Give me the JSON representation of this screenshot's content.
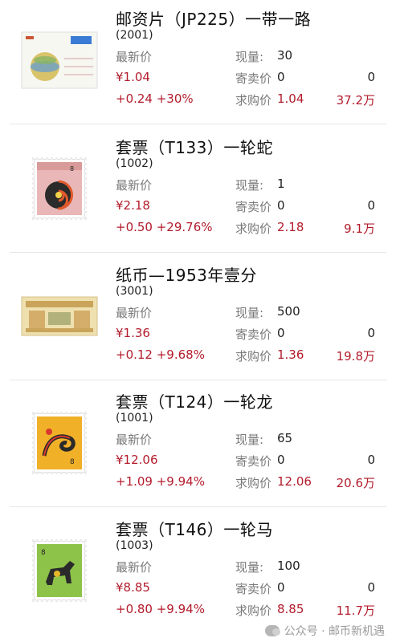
{
  "labels": {
    "latest_price": "最新价",
    "stock": "现量:",
    "consign": "寄卖价",
    "bid": "求购价"
  },
  "items": [
    {
      "title": "邮资片（JP225）一带一路",
      "code": "(2001)",
      "price": "¥1.04",
      "change": "+0.24 +30%",
      "stock_value": "30",
      "consign_value": "0",
      "consign_count": "0",
      "bid_value": "1.04",
      "bid_amount": "37.2万",
      "image": "postal-card"
    },
    {
      "title": "套票（T133）一轮蛇",
      "code": "(1002)",
      "price": "¥2.18",
      "change": "+0.50 +29.76%",
      "stock_value": "1",
      "consign_value": "0",
      "consign_count": "0",
      "bid_value": "2.18",
      "bid_amount": "9.1万",
      "image": "snake-stamp"
    },
    {
      "title": "纸币—1953年壹分",
      "code": "(3001)",
      "price": "¥1.36",
      "change": "+0.12 +9.68%",
      "stock_value": "500",
      "consign_value": "0",
      "consign_count": "0",
      "bid_value": "1.36",
      "bid_amount": "19.8万",
      "image": "banknote"
    },
    {
      "title": "套票（T124）一轮龙",
      "code": "(1001)",
      "price": "¥12.06",
      "change": "+1.09 +9.94%",
      "stock_value": "65",
      "consign_value": "0",
      "consign_count": "0",
      "bid_value": "12.06",
      "bid_amount": "20.6万",
      "image": "dragon-stamp"
    },
    {
      "title": "套票（T146）一轮马",
      "code": "(1003)",
      "price": "¥8.85",
      "change": "+0.80 +9.94%",
      "stock_value": "100",
      "consign_value": "0",
      "consign_count": "0",
      "bid_value": "8.85",
      "bid_amount": "11.7万",
      "image": "horse-stamp"
    }
  ],
  "watermark": {
    "text": "公众号 · 邮币新机遇"
  },
  "colors": {
    "accent_red": "#b31c2c",
    "label_gray": "#7a7a7a"
  }
}
